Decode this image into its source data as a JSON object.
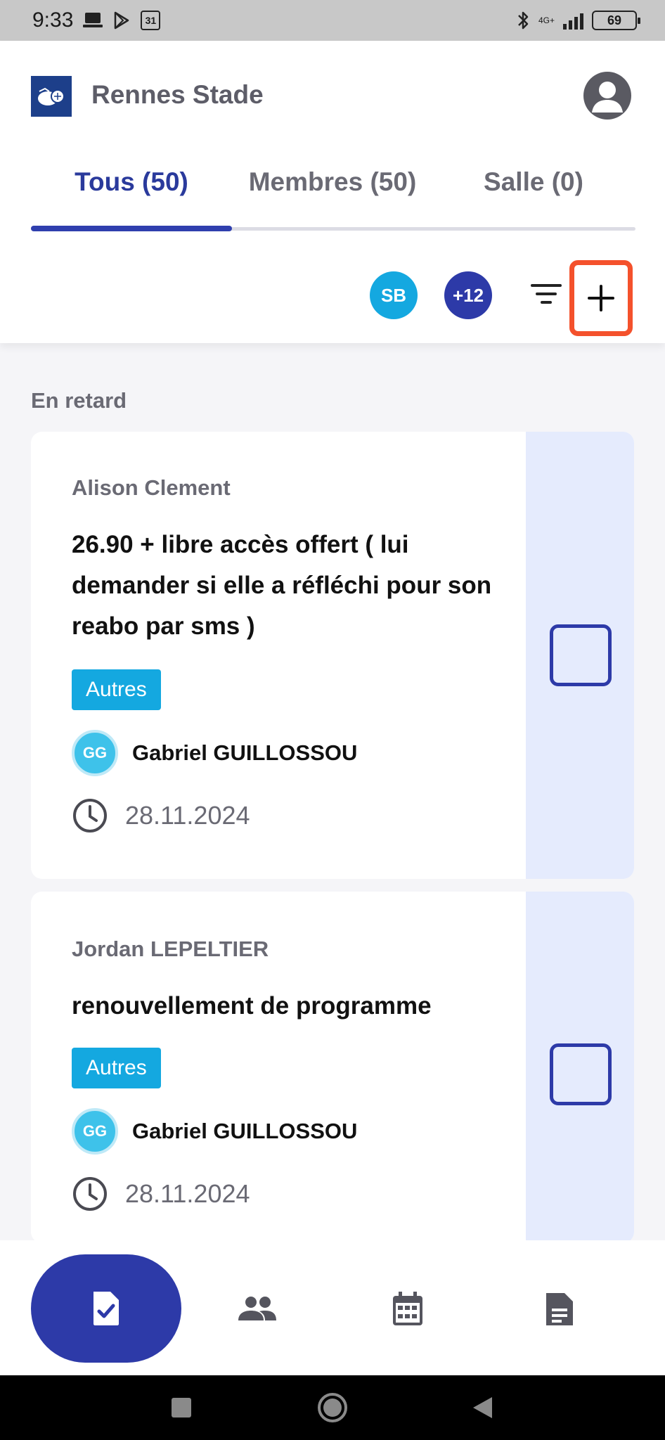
{
  "status_bar": {
    "time": "9:33",
    "calendar_day": "31",
    "network_label": "4G+",
    "battery": "69"
  },
  "header": {
    "club_name": "Rennes Stade",
    "tabs": [
      {
        "label": "Tous (50)",
        "active": true
      },
      {
        "label": "Membres (50)",
        "active": false
      },
      {
        "label": "Salle (0)",
        "active": false
      }
    ],
    "chips": {
      "initials": "SB",
      "more": "+12"
    }
  },
  "section": {
    "title": "En retard"
  },
  "tasks": [
    {
      "member": "Alison Clement",
      "title": "26.90 + libre accès offert ( lui demander si elle a réfléchi pour son reabo par sms )",
      "tag": "Autres",
      "assignee_initials": "GG",
      "assignee_name": "Gabriel GUILLOSSOU",
      "due_date": "28.11.2024",
      "done": false
    },
    {
      "member": "Jordan LEPELTIER",
      "title": "renouvellement de programme",
      "tag": "Autres",
      "assignee_initials": "GG",
      "assignee_name": "Gabriel GUILLOSSOU",
      "due_date": "28.11.2024",
      "done": false
    }
  ],
  "bottom_nav": {
    "items": [
      {
        "icon": "task-check-icon",
        "active": true
      },
      {
        "icon": "members-icon",
        "active": false
      },
      {
        "icon": "calendar-icon",
        "active": false
      },
      {
        "icon": "document-icon",
        "active": false
      }
    ]
  },
  "colors": {
    "primary": "#2d3aa8",
    "accent_tag": "#14a8e0",
    "highlight": "#f4512c",
    "side_panel": "#e5ebfd"
  }
}
